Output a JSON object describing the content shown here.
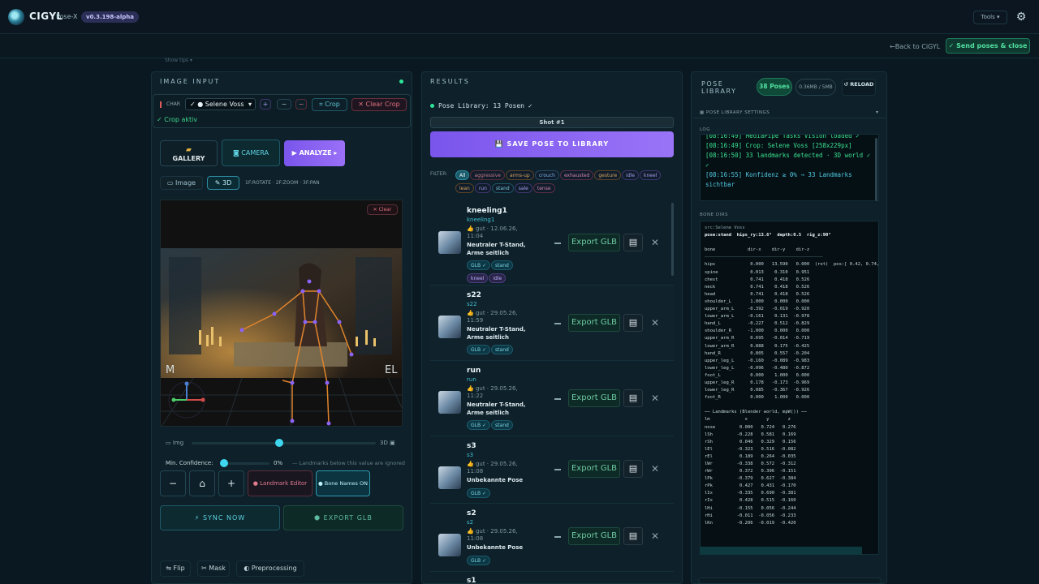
{
  "app": {
    "name": "CIGYL",
    "subtitle": "Pose-X",
    "version": "v0.3.198-alpha",
    "tools_label": "Tools",
    "show_tips": "Show tips ▾",
    "back_label": "←Back to CiGYL",
    "send_label": "✓ Send poses & close"
  },
  "image_input": {
    "title": "IMAGE INPUT",
    "char_label": "CHAR",
    "char_value": "✓ ● Selene Voss",
    "plus": "+",
    "minus": "−",
    "remove": "−",
    "crop": "⌗ Crop",
    "clear_crop": "✕ Clear Crop",
    "crop_status": "✓ Crop aktiv",
    "gallery": "GALLERY",
    "camera": "CAMERA",
    "analyze": "▶ ANALYZE ▸",
    "tab_image": "Image",
    "tab_3d": "3D",
    "hint": "1F:ROTATE · 2F:ZOOM · 3F:PAN",
    "clear": "✕ Clear",
    "label_m": "M",
    "label_el": "EL",
    "slider_img": "Img",
    "slider_3d": "3D",
    "min_conf_label": "Min. Confidence:",
    "min_conf_value": "0%",
    "min_conf_level": 0.0,
    "min_conf_note": "— Landmarks below this value are ignored",
    "minus_btn": "−",
    "home_btn": "⌂",
    "plus_btn": "+",
    "landmark_editor": "● Landmark Editor",
    "bone_names": "● Bone Names ON",
    "sync": "⚡ SYNC NOW",
    "export_glb": "⬢ EXPORT GLB",
    "flip": "⇋ Flip",
    "mask": "✂ Mask",
    "preprocessing": "◐ Preprocessing"
  },
  "results": {
    "title": "RESULTS",
    "library_status": "Pose Library: 13 Posen ✓",
    "shot": "Shot #1",
    "save": "💾 SAVE POSE TO LIBRARY",
    "filter_label": "FILTER:",
    "filters": [
      "All",
      "aggressive",
      "arms-up",
      "crouch",
      "exhausted",
      "gesture",
      "idle",
      "kneel",
      "lean",
      "run",
      "stand",
      "sale",
      "tense"
    ],
    "export_label": "Export GLB",
    "items": [
      {
        "name": "kneeling1",
        "sub": "kneeling1",
        "meta1": "👍 gut · 12.06.26,",
        "meta2": "11:04",
        "desc": "Neutraler T-Stand, Arme seitlich",
        "tags": [
          "GLB ✓",
          "stand",
          "kneel",
          "idle"
        ]
      },
      {
        "name": "s22",
        "sub": "s22",
        "meta1": "👍 gut · 29.05.26,",
        "meta2": "11:59",
        "desc": "Neutraler T-Stand, Arme seitlich",
        "tags": [
          "GLB ✓",
          "stand"
        ]
      },
      {
        "name": "run",
        "sub": "run",
        "meta1": "👍 gut · 29.05.26,",
        "meta2": "11:22",
        "desc": "Neutraler T-Stand, Arme seitlich",
        "tags": [
          "GLB ✓",
          "stand"
        ]
      },
      {
        "name": "s3",
        "sub": "s3",
        "meta1": "👍 gut · 29.05.26,",
        "meta2": "11:08",
        "desc": "Unbekannte Pose",
        "tags": [
          "GLB ✓"
        ]
      },
      {
        "name": "s2",
        "sub": "s2",
        "meta1": "👍 gut · 29.05.26,",
        "meta2": "11:08",
        "desc": "Unbekannte Pose",
        "tags": [
          "GLB ✓"
        ]
      },
      {
        "name": "s1",
        "sub": "",
        "meta1": "",
        "meta2": "",
        "desc": "",
        "tags": []
      }
    ]
  },
  "library": {
    "title1": "POSE",
    "title2": "LIBRARY",
    "count": "38 Poses",
    "size": "0.36MB / 5MB",
    "reload": "↺ RELOAD",
    "settings": "▦ POSE LIBRARY SETTINGS",
    "settings_arrow": "▾",
    "log_label": "LOG",
    "log": [
      {
        "t": "[08:16:49] MediaPipe Tasks Vision loaded ✓",
        "c": "g"
      },
      {
        "t": "[08:16:49] Crop: Selene Voss [258x229px]",
        "c": "g"
      },
      {
        "t": "[08:16:50] 33 landmarks detected · 3D world ✓",
        "c": "g"
      },
      {
        "t": "✓",
        "c": "g"
      },
      {
        "t": "[08:16:55] Konfidenz ≥ 0% → 33 Landmarks",
        "c": "c"
      },
      {
        "t": "sichtbar",
        "c": "c"
      }
    ],
    "bone_label": "BONE DIRS",
    "bone_char": "src:Selene Voss",
    "bone_pose": "pose:stand  hips_ry:13.6°  depth:0.5  rig_z:90°",
    "bone_header": "bone            dir-x    dir-y    dir-z",
    "bones": [
      "hips             0.000   13.590   0.000  (rot)  pos:[ 0.42, 0.74,",
      "spine            0.013    0.310   0.951",
      "chest            0.741    0.418   0.526",
      "neck             0.741    0.418   0.526",
      "head             0.741    0.418   0.526",
      "shoulder_L       1.000    0.000   0.000",
      "upper_arm_L     -0.392   -0.019  -0.920",
      "lower_arm_L     -0.161    0.131  -0.978",
      "hand_L          -0.227    0.512  -0.829",
      "shoulder_R      -1.000    0.000   0.000",
      "upper_arm_R      0.695   -0.014  -0.719",
      "lower_arm_R      0.888    0.175  -0.425",
      "hand_R           0.805    0.557  -0.204",
      "upper_leg_L     -0.160   -0.089  -0.983",
      "lower_leg_L     -0.096   -0.480  -0.872",
      "foot_L           0.000    1.000   0.000",
      "upper_leg_R      0.178   -0.173  -0.969",
      "lower_leg_R      0.085   -0.367  -0.926",
      "foot_R           0.000    1.000   0.000"
    ],
    "lm_header": "── Landmarks (Blender world, mpW()) ──",
    "lm_cols": "lm             x       y       z",
    "landmarks": [
      "nose         0.000   0.724   0.276",
      "lSh         -0.228   0.581   0.169",
      "rSh          0.046   0.329   0.156",
      "lEl         -0.323   0.516  -0.082",
      "rEl          0.189   0.264  -0.035",
      "lWr         -0.338   0.572  -0.312",
      "rWr          0.372   0.396  -0.151",
      "lPk         -0.379   0.627  -0.384",
      "rPk          0.427   0.431  -0.170",
      "lIx         -0.335   0.690  -0.381",
      "rIx          0.428   0.515  -0.160",
      "lHi         -0.155   0.056  -0.244",
      "rHi         -0.011  -0.056  -0.233",
      "lKn         -0.206  -0.019  -0.420"
    ]
  },
  "colors": {
    "accent": "#2ee69a",
    "purple": "#8b63f5",
    "teal": "#3fc1d4",
    "bg": "#0a1822"
  }
}
